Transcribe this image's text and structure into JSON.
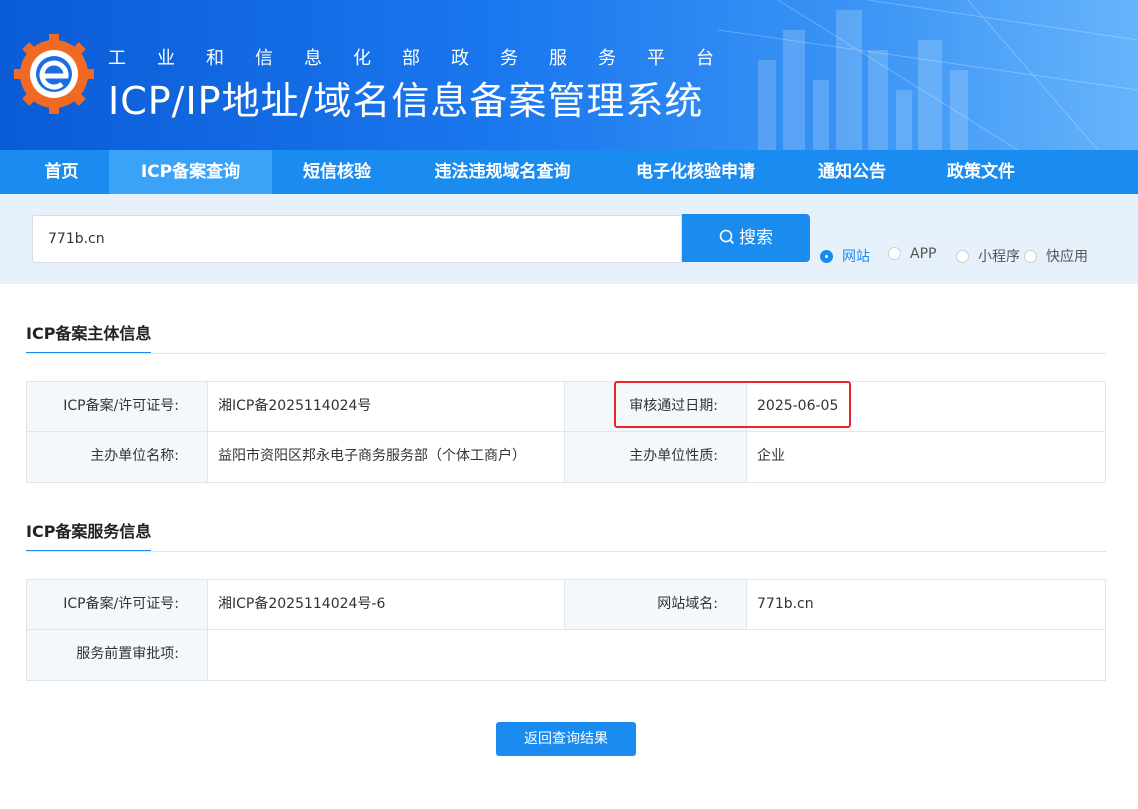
{
  "header": {
    "subtitle": "工业和信息化部政务服务平台",
    "title": "ICP/IP地址/域名信息备案管理系统"
  },
  "nav": [
    {
      "label": "首页"
    },
    {
      "label": "ICP备案查询"
    },
    {
      "label": "短信核验"
    },
    {
      "label": "违法违规域名查询"
    },
    {
      "label": "电子化核验申请"
    },
    {
      "label": "通知公告"
    },
    {
      "label": "政策文件"
    }
  ],
  "nav_active": "ICP备案查询",
  "search": {
    "value": "771b.cn",
    "button_label": "搜索",
    "types": [
      {
        "label": "网站",
        "checked": true
      },
      {
        "label": "APP",
        "checked": false
      },
      {
        "label": "小程序",
        "checked": false
      },
      {
        "label": "快应用",
        "checked": false
      }
    ]
  },
  "subject": {
    "title": "ICP备案主体信息",
    "license_label": "ICP备案/许可证号:",
    "license_value": "湘ICP备2025114024号",
    "approval_date_label": "审核通过日期:",
    "approval_date_value": "2025-06-05",
    "org_name_label": "主办单位名称:",
    "org_name_value": "益阳市资阳区邦永电子商务服务部（个体工商户）",
    "org_type_label": "主办单位性质:",
    "org_type_value": "企业"
  },
  "service": {
    "title": "ICP备案服务信息",
    "license_label": "ICP备案/许可证号:",
    "license_value": "湘ICP备2025114024号-6",
    "domain_label": "网站域名:",
    "domain_value": "771b.cn",
    "preapproval_label": "服务前置审批项:",
    "preapproval_value": ""
  },
  "back_button": "返回查询结果",
  "colors": {
    "primary": "#1a8cf0",
    "highlight": "#e8262b"
  }
}
